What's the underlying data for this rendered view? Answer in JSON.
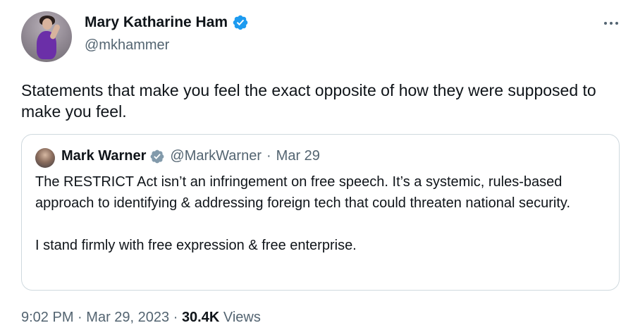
{
  "author": {
    "name": "Mary Katharine Ham",
    "handle": "@mkhammer",
    "badge_color": "#1d9bf0"
  },
  "tweet": {
    "text": "Statements that make you feel the exact opposite of how they were supposed to make you feel."
  },
  "quoted": {
    "name": "Mark Warner",
    "handle": "@MarkWarner",
    "separator": "·",
    "date": "Mar 29",
    "badge_color": "#829aab",
    "paragraphs": [
      "The RESTRICT Act isn’t an infringement on free speech. It’s a systemic, rules-based approach to identifying & addressing foreign tech that could threaten national security.",
      "I stand firmly with free expression & free enterprise."
    ]
  },
  "footer": {
    "time": "9:02 PM",
    "sep1": "·",
    "date": "Mar 29, 2023",
    "sep2": "·",
    "views_count": "30.4K",
    "views_label": "Views"
  },
  "icons": {
    "more": "more-horizontal-icon",
    "verified": "verified-badge-icon",
    "verified_gray": "verified-gray-badge-icon"
  },
  "colors": {
    "text_primary": "#0f1419",
    "text_secondary": "#536471",
    "border": "#cfd9de"
  }
}
